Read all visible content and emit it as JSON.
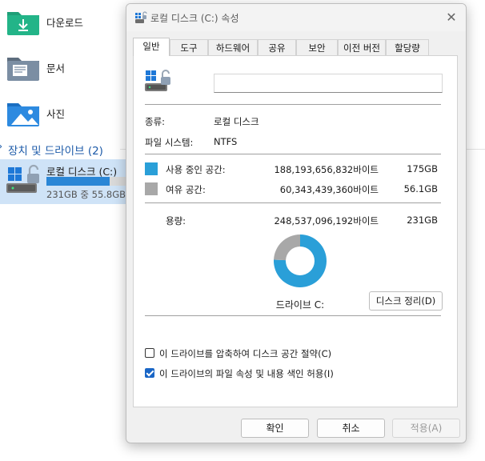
{
  "explorer": {
    "folders": [
      {
        "label": "다운로드",
        "icon": "download-folder-icon"
      },
      {
        "label": "문서",
        "icon": "documents-folder-icon"
      },
      {
        "label": "사진",
        "icon": "pictures-folder-icon"
      }
    ],
    "section_title": "장치 및 드라이브 (2)",
    "drive": {
      "name": "로컬 디스크 (C:)",
      "size_text": "231GB 중 55.8GB",
      "used_fraction": 0.76,
      "icon": "windows-drive-icon"
    }
  },
  "dialog": {
    "title": "로컬 디스크 (C:) 속성",
    "close_icon": "close-icon",
    "tabs": [
      "일반",
      "도구",
      "하드웨어",
      "공유",
      "보안",
      "이전 버전",
      "할당량"
    ],
    "active_tab": 0,
    "name_input_value": "",
    "type_label": "종류:",
    "type_value": "로컬 디스크",
    "fs_label": "파일 시스템:",
    "fs_value": "NTFS",
    "used": {
      "label": "사용 중인 공간:",
      "bytes": "188,193,656,832바이트",
      "size": "175GB",
      "color": "#2a9fd8"
    },
    "free": {
      "label": "여유 공간:",
      "bytes": "60,343,439,360바이트",
      "size": "56.1GB",
      "color": "#a8a8a8"
    },
    "capacity": {
      "label": "용량:",
      "bytes": "248,537,096,192바이트",
      "size": "231GB"
    },
    "drive_label": "드라이브 C:",
    "cleanup_button": "디스크 정리(D)",
    "compress_checkbox": {
      "label": "이 드라이브를 압축하여 디스크 공간 절약(C)",
      "checked": false
    },
    "index_checkbox": {
      "label": "이 드라이브의 파일 속성 및 내용 색인 허용(I)",
      "checked": true
    },
    "buttons": {
      "ok": "확인",
      "cancel": "취소",
      "apply": "적용(A)"
    }
  },
  "chart_data": {
    "type": "pie",
    "labels": [
      "사용 중인 공간",
      "여유 공간"
    ],
    "values": [
      188193656832,
      60343439360
    ],
    "colors": [
      "#2a9fd8",
      "#a8a8a8"
    ],
    "title": "드라이브 C:"
  }
}
